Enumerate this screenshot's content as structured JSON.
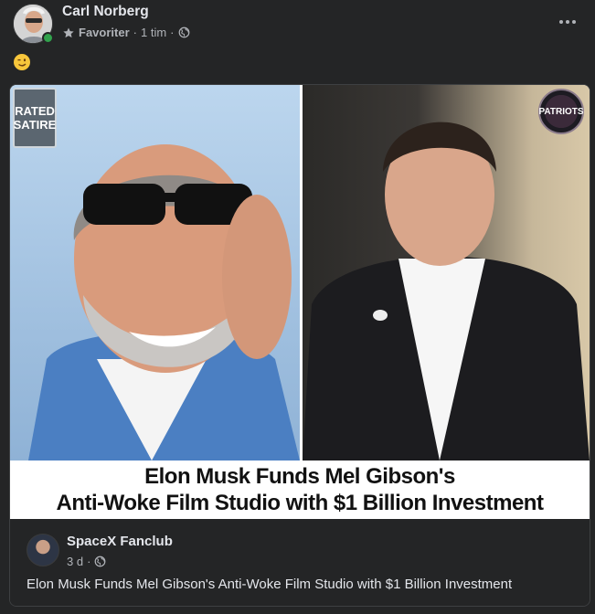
{
  "post": {
    "author": "Carl Norberg",
    "audience_label": "Favoriter",
    "separator": "·",
    "time": "1 tim",
    "emoji": "😉"
  },
  "shared": {
    "image": {
      "badge_line1": "RATED",
      "badge_line2": "SATIRE",
      "logo_text": "PATRIOTS",
      "headline_line1": "Elon Musk Funds Mel Gibson's",
      "headline_line2": "Anti-Woke Film Studio with $1 Billion Investment"
    },
    "page_name": "SpaceX Fanclub",
    "time": "3 d",
    "separator": "·",
    "text": "Elon Musk Funds Mel Gibson's Anti-Woke Film Studio with $1 Billion Investment"
  },
  "icons": [
    "star-icon",
    "globe-icon",
    "more-options-icon",
    "winking-face-emoji",
    "online-status-icon"
  ],
  "colors": {
    "background": "#242526",
    "text": "#e4e6eb",
    "secondary": "#b0b3b8",
    "online": "#31a24c"
  }
}
